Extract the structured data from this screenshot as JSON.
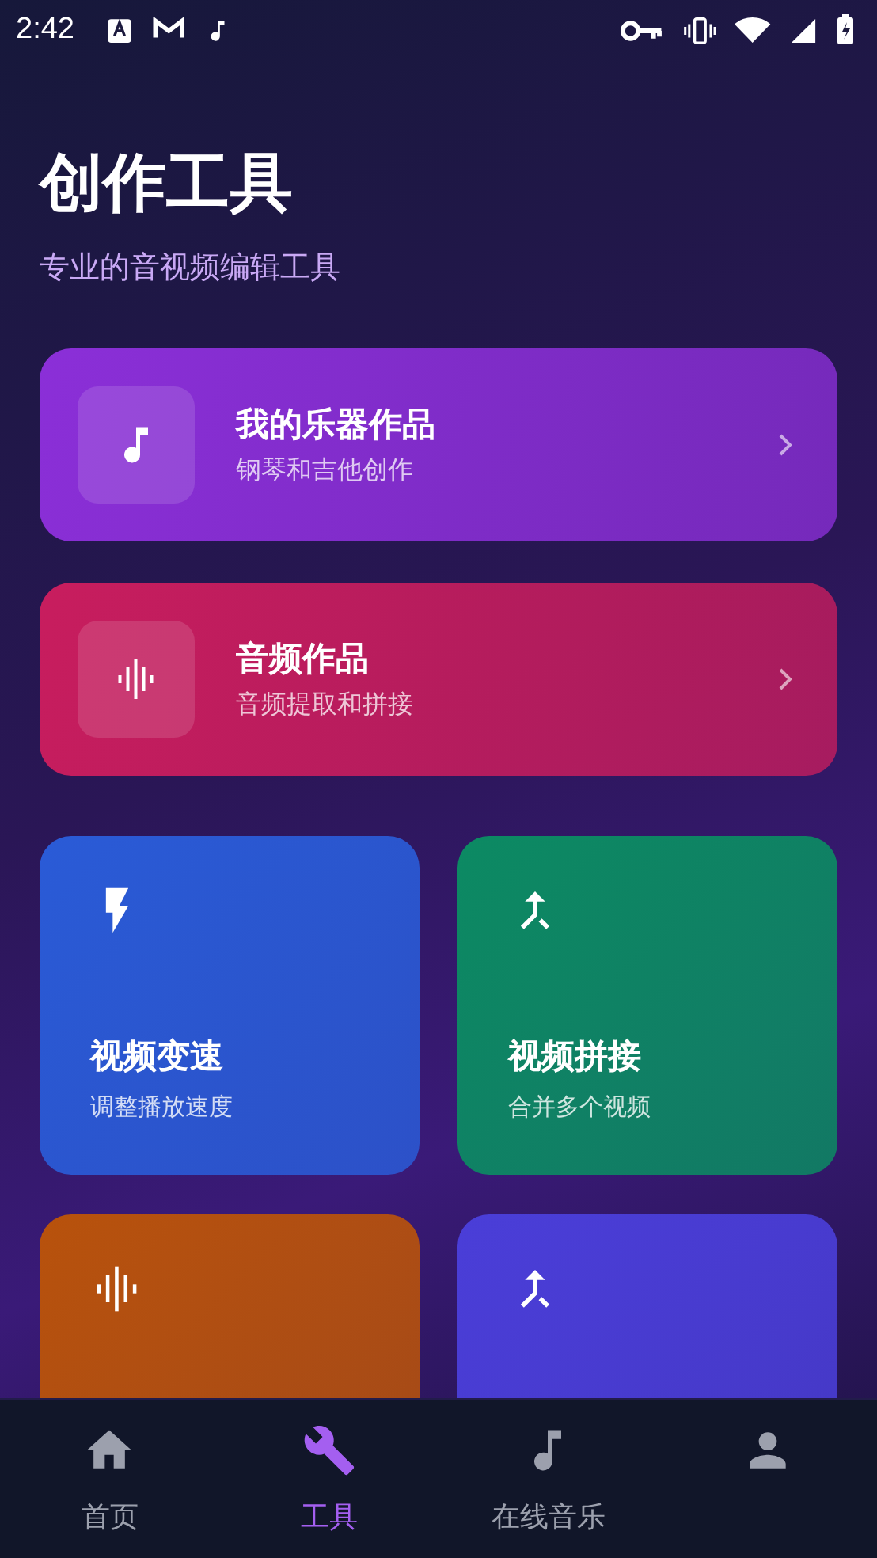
{
  "status_bar": {
    "time": "2:42"
  },
  "header": {
    "title": "创作工具",
    "subtitle": "专业的音视频编辑工具"
  },
  "feature_cards": [
    {
      "kind": "music",
      "title": "我的乐器作品",
      "subtitle": "钢琴和吉他创作",
      "color": "#8b2fd8"
    },
    {
      "kind": "wave",
      "title": "音频作品",
      "subtitle": "音频提取和拼接",
      "color": "#c81d5e"
    }
  ],
  "tool_cards": [
    {
      "kind": "bolt",
      "title": "视频变速",
      "subtitle": "调整播放速度",
      "color": "#2a5bd7"
    },
    {
      "kind": "merge",
      "title": "视频拼接",
      "subtitle": "合并多个视频",
      "color": "#0c8a63"
    },
    {
      "kind": "wave",
      "color": "#b8520c"
    },
    {
      "kind": "merge",
      "color": "#4a3ed8"
    }
  ],
  "bottom_nav": [
    {
      "kind": "home",
      "label": "首页",
      "selected": false
    },
    {
      "kind": "wrench",
      "label": "工具",
      "selected": true
    },
    {
      "kind": "music",
      "label": "在线音乐",
      "selected": false
    },
    {
      "kind": "person",
      "selected": false
    }
  ]
}
